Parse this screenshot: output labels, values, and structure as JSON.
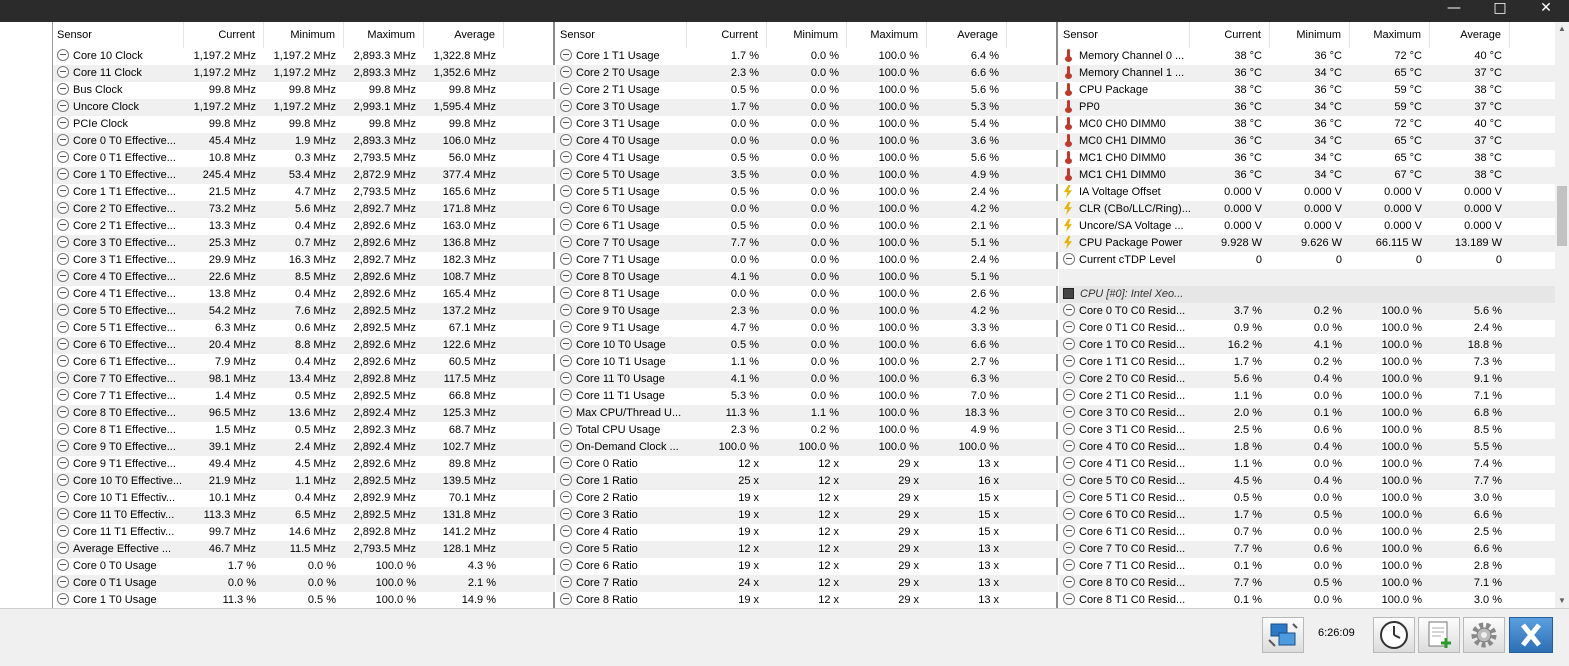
{
  "window": {
    "minimize_icon": "minimize-icon",
    "maximize_icon": "maximize-icon",
    "close_icon": "close-icon"
  },
  "columns": {
    "sensor": "Sensor",
    "current": "Current",
    "minimum": "Minimum",
    "maximum": "Maximum",
    "average": "Average"
  },
  "panel1": [
    {
      "icon": "minus",
      "name": "Core 10 Clock",
      "cur": "1,197.2 MHz",
      "min": "1,197.2 MHz",
      "max": "2,893.3 MHz",
      "avg": "1,322.8 MHz"
    },
    {
      "icon": "minus",
      "name": "Core 11 Clock",
      "cur": "1,197.2 MHz",
      "min": "1,197.2 MHz",
      "max": "2,893.3 MHz",
      "avg": "1,352.6 MHz"
    },
    {
      "icon": "minus",
      "name": "Bus Clock",
      "cur": "99.8 MHz",
      "min": "99.8 MHz",
      "max": "99.8 MHz",
      "avg": "99.8 MHz"
    },
    {
      "icon": "minus",
      "name": "Uncore Clock",
      "cur": "1,197.2 MHz",
      "min": "1,197.2 MHz",
      "max": "2,993.1 MHz",
      "avg": "1,595.4 MHz"
    },
    {
      "icon": "minus",
      "name": "PCIe Clock",
      "cur": "99.8 MHz",
      "min": "99.8 MHz",
      "max": "99.8 MHz",
      "avg": "99.8 MHz"
    },
    {
      "icon": "minus",
      "name": "Core 0 T0 Effective...",
      "cur": "45.4 MHz",
      "min": "1.9 MHz",
      "max": "2,893.3 MHz",
      "avg": "106.0 MHz"
    },
    {
      "icon": "minus",
      "name": "Core 0 T1 Effective...",
      "cur": "10.8 MHz",
      "min": "0.3 MHz",
      "max": "2,793.5 MHz",
      "avg": "56.0 MHz"
    },
    {
      "icon": "minus",
      "name": "Core 1 T0 Effective...",
      "cur": "245.4 MHz",
      "min": "53.4 MHz",
      "max": "2,872.9 MHz",
      "avg": "377.4 MHz"
    },
    {
      "icon": "minus",
      "name": "Core 1 T1 Effective...",
      "cur": "21.5 MHz",
      "min": "4.7 MHz",
      "max": "2,793.5 MHz",
      "avg": "165.6 MHz"
    },
    {
      "icon": "minus",
      "name": "Core 2 T0 Effective...",
      "cur": "73.2 MHz",
      "min": "5.6 MHz",
      "max": "2,892.7 MHz",
      "avg": "171.8 MHz"
    },
    {
      "icon": "minus",
      "name": "Core 2 T1 Effective...",
      "cur": "13.3 MHz",
      "min": "0.4 MHz",
      "max": "2,892.6 MHz",
      "avg": "163.0 MHz"
    },
    {
      "icon": "minus",
      "name": "Core 3 T0 Effective...",
      "cur": "25.3 MHz",
      "min": "0.7 MHz",
      "max": "2,892.6 MHz",
      "avg": "136.8 MHz"
    },
    {
      "icon": "minus",
      "name": "Core 3 T1 Effective...",
      "cur": "29.9 MHz",
      "min": "16.3 MHz",
      "max": "2,892.7 MHz",
      "avg": "182.3 MHz"
    },
    {
      "icon": "minus",
      "name": "Core 4 T0 Effective...",
      "cur": "22.6 MHz",
      "min": "8.5 MHz",
      "max": "2,892.6 MHz",
      "avg": "108.7 MHz"
    },
    {
      "icon": "minus",
      "name": "Core 4 T1 Effective...",
      "cur": "13.8 MHz",
      "min": "0.4 MHz",
      "max": "2,892.6 MHz",
      "avg": "165.4 MHz"
    },
    {
      "icon": "minus",
      "name": "Core 5 T0 Effective...",
      "cur": "54.2 MHz",
      "min": "7.6 MHz",
      "max": "2,892.5 MHz",
      "avg": "137.2 MHz"
    },
    {
      "icon": "minus",
      "name": "Core 5 T1 Effective...",
      "cur": "6.3 MHz",
      "min": "0.6 MHz",
      "max": "2,892.5 MHz",
      "avg": "67.1 MHz"
    },
    {
      "icon": "minus",
      "name": "Core 6 T0 Effective...",
      "cur": "20.4 MHz",
      "min": "8.8 MHz",
      "max": "2,892.6 MHz",
      "avg": "122.6 MHz"
    },
    {
      "icon": "minus",
      "name": "Core 6 T1 Effective...",
      "cur": "7.9 MHz",
      "min": "0.4 MHz",
      "max": "2,892.6 MHz",
      "avg": "60.5 MHz"
    },
    {
      "icon": "minus",
      "name": "Core 7 T0 Effective...",
      "cur": "98.1 MHz",
      "min": "13.4 MHz",
      "max": "2,892.8 MHz",
      "avg": "117.5 MHz"
    },
    {
      "icon": "minus",
      "name": "Core 7 T1 Effective...",
      "cur": "1.4 MHz",
      "min": "0.5 MHz",
      "max": "2,892.5 MHz",
      "avg": "66.8 MHz"
    },
    {
      "icon": "minus",
      "name": "Core 8 T0 Effective...",
      "cur": "96.5 MHz",
      "min": "13.6 MHz",
      "max": "2,892.4 MHz",
      "avg": "125.3 MHz"
    },
    {
      "icon": "minus",
      "name": "Core 8 T1 Effective...",
      "cur": "1.5 MHz",
      "min": "0.5 MHz",
      "max": "2,892.3 MHz",
      "avg": "68.7 MHz"
    },
    {
      "icon": "minus",
      "name": "Core 9 T0 Effective...",
      "cur": "39.1 MHz",
      "min": "2.4 MHz",
      "max": "2,892.4 MHz",
      "avg": "102.7 MHz"
    },
    {
      "icon": "minus",
      "name": "Core 9 T1 Effective...",
      "cur": "49.4 MHz",
      "min": "4.5 MHz",
      "max": "2,892.6 MHz",
      "avg": "89.8 MHz"
    },
    {
      "icon": "minus",
      "name": "Core 10 T0 Effective...",
      "cur": "21.9 MHz",
      "min": "1.1 MHz",
      "max": "2,892.5 MHz",
      "avg": "139.5 MHz"
    },
    {
      "icon": "minus",
      "name": "Core 10 T1 Effectiv...",
      "cur": "10.1 MHz",
      "min": "0.4 MHz",
      "max": "2,892.9 MHz",
      "avg": "70.1 MHz"
    },
    {
      "icon": "minus",
      "name": "Core 11 T0 Effectiv...",
      "cur": "113.3 MHz",
      "min": "6.5 MHz",
      "max": "2,892.5 MHz",
      "avg": "131.8 MHz"
    },
    {
      "icon": "minus",
      "name": "Core 11 T1 Effectiv...",
      "cur": "99.7 MHz",
      "min": "14.6 MHz",
      "max": "2,892.8 MHz",
      "avg": "141.2 MHz"
    },
    {
      "icon": "minus",
      "name": "Average Effective ...",
      "cur": "46.7 MHz",
      "min": "11.5 MHz",
      "max": "2,793.5 MHz",
      "avg": "128.1 MHz"
    },
    {
      "icon": "minus",
      "name": "Core 0 T0 Usage",
      "cur": "1.7 %",
      "min": "0.0 %",
      "max": "100.0 %",
      "avg": "4.3 %"
    },
    {
      "icon": "minus",
      "name": "Core 0 T1 Usage",
      "cur": "0.0 %",
      "min": "0.0 %",
      "max": "100.0 %",
      "avg": "2.1 %"
    },
    {
      "icon": "minus",
      "name": "Core 1 T0 Usage",
      "cur": "11.3 %",
      "min": "0.5 %",
      "max": "100.0 %",
      "avg": "14.9 %"
    }
  ],
  "panel2": [
    {
      "icon": "minus",
      "name": "Core 1 T1 Usage",
      "cur": "1.7 %",
      "min": "0.0 %",
      "max": "100.0 %",
      "avg": "6.4 %"
    },
    {
      "icon": "minus",
      "name": "Core 2 T0 Usage",
      "cur": "2.3 %",
      "min": "0.0 %",
      "max": "100.0 %",
      "avg": "6.6 %"
    },
    {
      "icon": "minus",
      "name": "Core 2 T1 Usage",
      "cur": "0.5 %",
      "min": "0.0 %",
      "max": "100.0 %",
      "avg": "5.6 %"
    },
    {
      "icon": "minus",
      "name": "Core 3 T0 Usage",
      "cur": "1.7 %",
      "min": "0.0 %",
      "max": "100.0 %",
      "avg": "5.3 %"
    },
    {
      "icon": "minus",
      "name": "Core 3 T1 Usage",
      "cur": "0.0 %",
      "min": "0.0 %",
      "max": "100.0 %",
      "avg": "5.4 %"
    },
    {
      "icon": "minus",
      "name": "Core 4 T0 Usage",
      "cur": "0.0 %",
      "min": "0.0 %",
      "max": "100.0 %",
      "avg": "3.6 %"
    },
    {
      "icon": "minus",
      "name": "Core 4 T1 Usage",
      "cur": "0.5 %",
      "min": "0.0 %",
      "max": "100.0 %",
      "avg": "5.6 %"
    },
    {
      "icon": "minus",
      "name": "Core 5 T0 Usage",
      "cur": "3.5 %",
      "min": "0.0 %",
      "max": "100.0 %",
      "avg": "4.9 %"
    },
    {
      "icon": "minus",
      "name": "Core 5 T1 Usage",
      "cur": "0.5 %",
      "min": "0.0 %",
      "max": "100.0 %",
      "avg": "2.4 %"
    },
    {
      "icon": "minus",
      "name": "Core 6 T0 Usage",
      "cur": "0.0 %",
      "min": "0.0 %",
      "max": "100.0 %",
      "avg": "4.2 %"
    },
    {
      "icon": "minus",
      "name": "Core 6 T1 Usage",
      "cur": "0.5 %",
      "min": "0.0 %",
      "max": "100.0 %",
      "avg": "2.1 %"
    },
    {
      "icon": "minus",
      "name": "Core 7 T0 Usage",
      "cur": "7.7 %",
      "min": "0.0 %",
      "max": "100.0 %",
      "avg": "5.1 %"
    },
    {
      "icon": "minus",
      "name": "Core 7 T1 Usage",
      "cur": "0.0 %",
      "min": "0.0 %",
      "max": "100.0 %",
      "avg": "2.4 %"
    },
    {
      "icon": "minus",
      "name": "Core 8 T0 Usage",
      "cur": "4.1 %",
      "min": "0.0 %",
      "max": "100.0 %",
      "avg": "5.1 %"
    },
    {
      "icon": "minus",
      "name": "Core 8 T1 Usage",
      "cur": "0.0 %",
      "min": "0.0 %",
      "max": "100.0 %",
      "avg": "2.6 %"
    },
    {
      "icon": "minus",
      "name": "Core 9 T0 Usage",
      "cur": "2.3 %",
      "min": "0.0 %",
      "max": "100.0 %",
      "avg": "4.2 %"
    },
    {
      "icon": "minus",
      "name": "Core 9 T1 Usage",
      "cur": "4.7 %",
      "min": "0.0 %",
      "max": "100.0 %",
      "avg": "3.3 %"
    },
    {
      "icon": "minus",
      "name": "Core 10 T0 Usage",
      "cur": "0.5 %",
      "min": "0.0 %",
      "max": "100.0 %",
      "avg": "6.6 %"
    },
    {
      "icon": "minus",
      "name": "Core 10 T1 Usage",
      "cur": "1.1 %",
      "min": "0.0 %",
      "max": "100.0 %",
      "avg": "2.7 %"
    },
    {
      "icon": "minus",
      "name": "Core 11 T0 Usage",
      "cur": "4.1 %",
      "min": "0.0 %",
      "max": "100.0 %",
      "avg": "6.3 %"
    },
    {
      "icon": "minus",
      "name": "Core 11 T1 Usage",
      "cur": "5.3 %",
      "min": "0.0 %",
      "max": "100.0 %",
      "avg": "7.0 %"
    },
    {
      "icon": "minus",
      "name": "Max CPU/Thread U...",
      "cur": "11.3 %",
      "min": "1.1 %",
      "max": "100.0 %",
      "avg": "18.3 %"
    },
    {
      "icon": "minus",
      "name": "Total CPU Usage",
      "cur": "2.3 %",
      "min": "0.2 %",
      "max": "100.0 %",
      "avg": "4.9 %"
    },
    {
      "icon": "minus",
      "name": "On-Demand Clock ...",
      "cur": "100.0 %",
      "min": "100.0 %",
      "max": "100.0 %",
      "avg": "100.0 %"
    },
    {
      "icon": "minus",
      "name": "Core 0 Ratio",
      "cur": "12 x",
      "min": "12 x",
      "max": "29 x",
      "avg": "13 x"
    },
    {
      "icon": "minus",
      "name": "Core 1 Ratio",
      "cur": "25 x",
      "min": "12 x",
      "max": "29 x",
      "avg": "16 x"
    },
    {
      "icon": "minus",
      "name": "Core 2 Ratio",
      "cur": "19 x",
      "min": "12 x",
      "max": "29 x",
      "avg": "15 x"
    },
    {
      "icon": "minus",
      "name": "Core 3 Ratio",
      "cur": "19 x",
      "min": "12 x",
      "max": "29 x",
      "avg": "15 x"
    },
    {
      "icon": "minus",
      "name": "Core 4 Ratio",
      "cur": "19 x",
      "min": "12 x",
      "max": "29 x",
      "avg": "15 x"
    },
    {
      "icon": "minus",
      "name": "Core 5 Ratio",
      "cur": "12 x",
      "min": "12 x",
      "max": "29 x",
      "avg": "13 x"
    },
    {
      "icon": "minus",
      "name": "Core 6 Ratio",
      "cur": "19 x",
      "min": "12 x",
      "max": "29 x",
      "avg": "13 x"
    },
    {
      "icon": "minus",
      "name": "Core 7 Ratio",
      "cur": "24 x",
      "min": "12 x",
      "max": "29 x",
      "avg": "13 x"
    },
    {
      "icon": "minus",
      "name": "Core 8 Ratio",
      "cur": "19 x",
      "min": "12 x",
      "max": "29 x",
      "avg": "13 x"
    }
  ],
  "panel3": [
    {
      "icon": "therm",
      "name": "Memory Channel 0 ...",
      "cur": "38 °C",
      "min": "36 °C",
      "max": "72 °C",
      "avg": "40 °C"
    },
    {
      "icon": "therm",
      "name": "Memory Channel 1 ...",
      "cur": "36 °C",
      "min": "34 °C",
      "max": "65 °C",
      "avg": "37 °C"
    },
    {
      "icon": "therm",
      "name": "CPU Package",
      "cur": "38 °C",
      "min": "36 °C",
      "max": "59 °C",
      "avg": "38 °C"
    },
    {
      "icon": "therm",
      "name": "PP0",
      "cur": "36 °C",
      "min": "34 °C",
      "max": "59 °C",
      "avg": "37 °C"
    },
    {
      "icon": "therm",
      "name": "MC0 CH0 DIMM0",
      "cur": "38 °C",
      "min": "36 °C",
      "max": "72 °C",
      "avg": "40 °C"
    },
    {
      "icon": "therm",
      "name": "MC0 CH1 DIMM0",
      "cur": "36 °C",
      "min": "34 °C",
      "max": "65 °C",
      "avg": "37 °C"
    },
    {
      "icon": "therm",
      "name": "MC1 CH0 DIMM0",
      "cur": "36 °C",
      "min": "34 °C",
      "max": "65 °C",
      "avg": "38 °C"
    },
    {
      "icon": "therm",
      "name": "MC1 CH1 DIMM0",
      "cur": "36 °C",
      "min": "34 °C",
      "max": "67 °C",
      "avg": "38 °C"
    },
    {
      "icon": "bolt",
      "name": "IA Voltage Offset",
      "cur": "0.000 V",
      "min": "0.000 V",
      "max": "0.000 V",
      "avg": "0.000 V"
    },
    {
      "icon": "bolt",
      "name": "CLR (CBo/LLC/Ring)...",
      "cur": "0.000 V",
      "min": "0.000 V",
      "max": "0.000 V",
      "avg": "0.000 V"
    },
    {
      "icon": "bolt",
      "name": "Uncore/SA Voltage ...",
      "cur": "0.000 V",
      "min": "0.000 V",
      "max": "0.000 V",
      "avg": "0.000 V"
    },
    {
      "icon": "bolt",
      "name": "CPU Package Power",
      "cur": "9.928 W",
      "min": "9.626 W",
      "max": "66.115 W",
      "avg": "13.189 W"
    },
    {
      "icon": "minus",
      "name": "Current cTDP Level",
      "cur": "0",
      "min": "0",
      "max": "0",
      "avg": "0"
    },
    {
      "icon": "blank",
      "name": "",
      "cur": "",
      "min": "",
      "max": "",
      "avg": ""
    },
    {
      "icon": "chip",
      "name": "CPU [#0]: Intel Xeo...",
      "cur": "",
      "min": "",
      "max": "",
      "avg": "",
      "group": true
    },
    {
      "icon": "minus",
      "name": "Core 0 T0 C0 Resid...",
      "cur": "3.7 %",
      "min": "0.2 %",
      "max": "100.0 %",
      "avg": "5.6 %"
    },
    {
      "icon": "minus",
      "name": "Core 0 T1 C0 Resid...",
      "cur": "0.9 %",
      "min": "0.0 %",
      "max": "100.0 %",
      "avg": "2.4 %"
    },
    {
      "icon": "minus",
      "name": "Core 1 T0 C0 Resid...",
      "cur": "16.2 %",
      "min": "4.1 %",
      "max": "100.0 %",
      "avg": "18.8 %"
    },
    {
      "icon": "minus",
      "name": "Core 1 T1 C0 Resid...",
      "cur": "1.7 %",
      "min": "0.2 %",
      "max": "100.0 %",
      "avg": "7.3 %"
    },
    {
      "icon": "minus",
      "name": "Core 2 T0 C0 Resid...",
      "cur": "5.6 %",
      "min": "0.4 %",
      "max": "100.0 %",
      "avg": "9.1 %"
    },
    {
      "icon": "minus",
      "name": "Core 2 T1 C0 Resid...",
      "cur": "1.1 %",
      "min": "0.0 %",
      "max": "100.0 %",
      "avg": "7.1 %"
    },
    {
      "icon": "minus",
      "name": "Core 3 T0 C0 Resid...",
      "cur": "2.0 %",
      "min": "0.1 %",
      "max": "100.0 %",
      "avg": "6.8 %"
    },
    {
      "icon": "minus",
      "name": "Core 3 T1 C0 Resid...",
      "cur": "2.5 %",
      "min": "0.6 %",
      "max": "100.0 %",
      "avg": "8.5 %"
    },
    {
      "icon": "minus",
      "name": "Core 4 T0 C0 Resid...",
      "cur": "1.8 %",
      "min": "0.4 %",
      "max": "100.0 %",
      "avg": "5.5 %"
    },
    {
      "icon": "minus",
      "name": "Core 4 T1 C0 Resid...",
      "cur": "1.1 %",
      "min": "0.0 %",
      "max": "100.0 %",
      "avg": "7.4 %"
    },
    {
      "icon": "minus",
      "name": "Core 5 T0 C0 Resid...",
      "cur": "4.5 %",
      "min": "0.4 %",
      "max": "100.0 %",
      "avg": "7.7 %"
    },
    {
      "icon": "minus",
      "name": "Core 5 T1 C0 Resid...",
      "cur": "0.5 %",
      "min": "0.0 %",
      "max": "100.0 %",
      "avg": "3.0 %"
    },
    {
      "icon": "minus",
      "name": "Core 6 T0 C0 Resid...",
      "cur": "1.7 %",
      "min": "0.5 %",
      "max": "100.0 %",
      "avg": "6.6 %"
    },
    {
      "icon": "minus",
      "name": "Core 6 T1 C0 Resid...",
      "cur": "0.7 %",
      "min": "0.0 %",
      "max": "100.0 %",
      "avg": "2.5 %"
    },
    {
      "icon": "minus",
      "name": "Core 7 T0 C0 Resid...",
      "cur": "7.7 %",
      "min": "0.6 %",
      "max": "100.0 %",
      "avg": "6.6 %"
    },
    {
      "icon": "minus",
      "name": "Core 7 T1 C0 Resid...",
      "cur": "0.1 %",
      "min": "0.0 %",
      "max": "100.0 %",
      "avg": "2.8 %"
    },
    {
      "icon": "minus",
      "name": "Core 8 T0 C0 Resid...",
      "cur": "7.7 %",
      "min": "0.5 %",
      "max": "100.0 %",
      "avg": "7.1 %"
    },
    {
      "icon": "minus",
      "name": "Core 8 T1 C0 Resid...",
      "cur": "0.1 %",
      "min": "0.0 %",
      "max": "100.0 %",
      "avg": "3.0 %"
    }
  ],
  "statusbar": {
    "time": "6:26:09",
    "buttons": [
      "network-icon",
      "clock-icon",
      "add-report-icon",
      "settings-gear-icon",
      "close-icon"
    ]
  }
}
